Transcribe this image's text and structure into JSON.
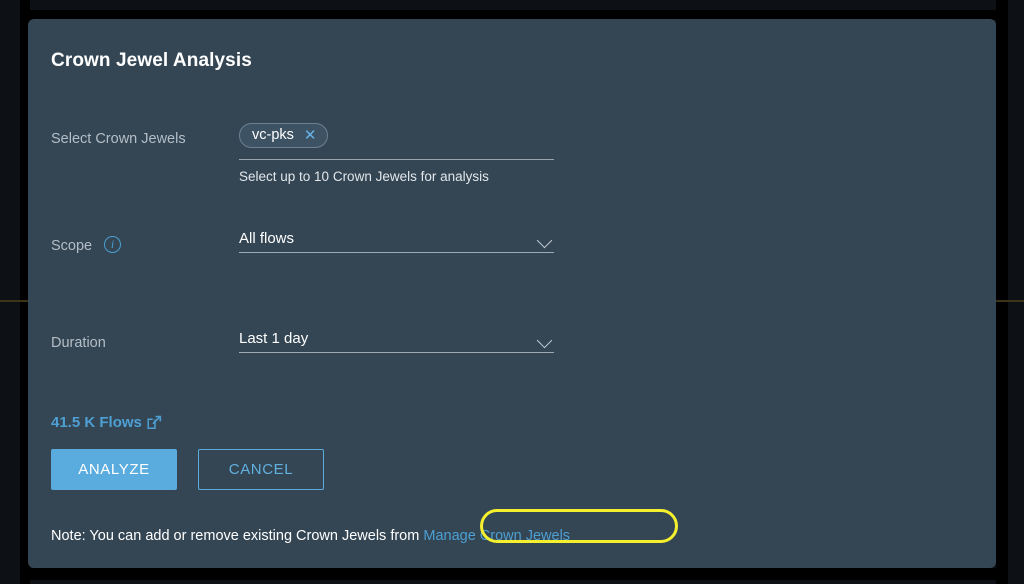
{
  "dialog": {
    "title": "Crown Jewel Analysis",
    "fields": {
      "crown_jewels": {
        "label": "Select Crown Jewels",
        "chips": [
          {
            "text": "vc-pks",
            "close_icon": "close-icon"
          }
        ],
        "helper_text": "Select up to 10 Crown Jewels for analysis"
      },
      "scope": {
        "label": "Scope",
        "info_icon": "info-icon",
        "info_glyph": "i",
        "value": "All flows",
        "chevron_icon": "chevron-down-icon"
      },
      "duration": {
        "label": "Duration",
        "value": "Last 1 day",
        "chevron_icon": "chevron-down-icon"
      }
    },
    "flows_link": {
      "label": "41.5 K Flows",
      "icon": "external-link-icon"
    },
    "buttons": {
      "primary": "ANALYZE",
      "secondary": "CANCEL"
    },
    "note": {
      "prefix": "Note: You can add or remove existing Crown Jewels from ",
      "link": "Manage Crown Jewels"
    }
  },
  "colors": {
    "modal_background": "#344654",
    "backdrop": "#0d1115",
    "accent_blue": "#4e9fd3",
    "primary_button": "#5aabde",
    "highlight_ring": "#f5f02e",
    "label_text": "#b4bec6"
  }
}
